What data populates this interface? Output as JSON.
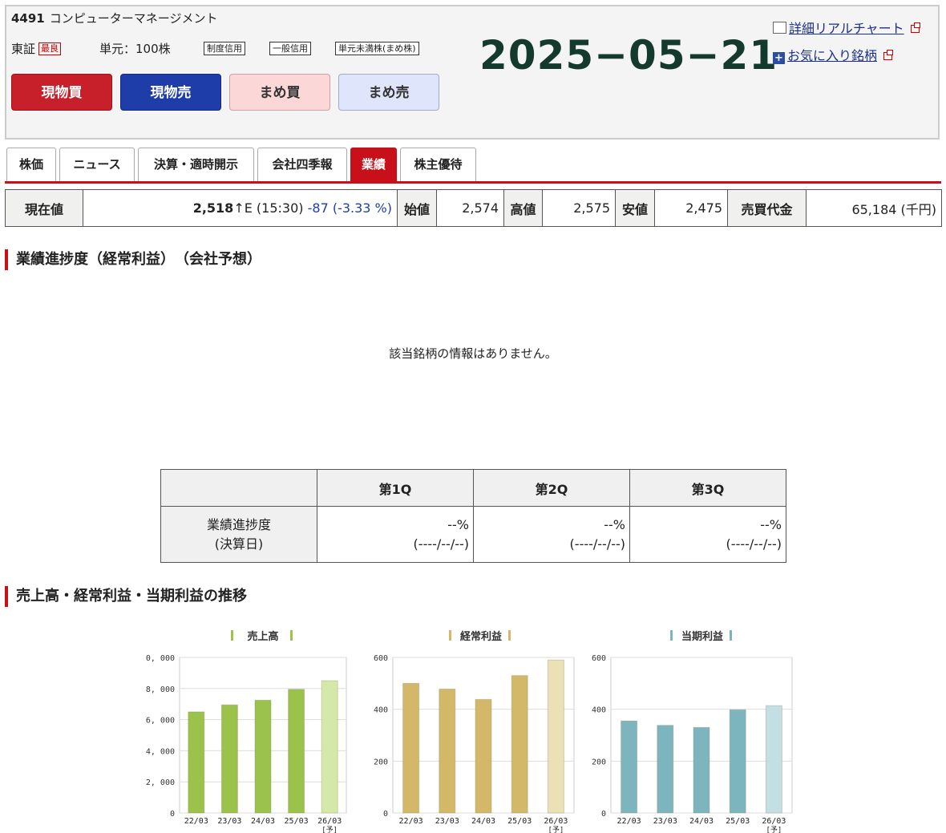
{
  "stock": {
    "code": "4491",
    "name": "コンピューターマネージメント",
    "exchange": "東証",
    "market_badge": "最良",
    "unit": "単元：100株",
    "tags": [
      "制度信用",
      "一般信用",
      "単元未満株(まめ株)"
    ]
  },
  "trade_buttons": {
    "buy": "現物買",
    "sell": "現物売",
    "mame_buy": "まめ買",
    "mame_sell": "まめ売"
  },
  "date": "2025−05−21",
  "links": {
    "chart": "詳細リアルチャート",
    "favorite": "お気に入り銘柄"
  },
  "tabs": [
    "株価",
    "ニュース",
    "決算・適時開示",
    "会社四季報",
    "業績",
    "株主優待"
  ],
  "active_tab": "業績",
  "quote": {
    "current_label": "現在値",
    "price": "2,518",
    "arrow": "↑E",
    "time": "(15:30)",
    "change": "-87 (-3.33 %)",
    "open_label": "始値",
    "open": "2,574",
    "high_label": "高値",
    "high": "2,575",
    "low_label": "安値",
    "low": "2,475",
    "volume_label": "売買代金",
    "volume": "65,184 (千円)"
  },
  "progress_section": {
    "title": "業績進捗度（経常利益）　（会社予想）",
    "no_data": "該当銘柄の情報はありません。",
    "headers": [
      "第1Q",
      "第2Q",
      "第3Q"
    ],
    "row_label_1": "業績進捗度",
    "row_label_2": "(決算日)",
    "values": [
      {
        "pct": "--%",
        "date": "(----/--/--)"
      },
      {
        "pct": "--%",
        "date": "(----/--/--)"
      },
      {
        "pct": "--%",
        "date": "(----/--/--)"
      }
    ]
  },
  "trend_section": {
    "title": "売上高・経常利益・当期利益の推移"
  },
  "chart_data": [
    {
      "type": "bar",
      "title": "売上高",
      "color": "#9bc24a",
      "forecast_color": "#d4e8a8",
      "categories": [
        "22/03",
        "23/03",
        "24/03",
        "25/03",
        "26/03"
      ],
      "forecast_note": "[予]",
      "values": [
        6500,
        6950,
        7250,
        7950,
        8500
      ],
      "yticks": [
        "0, 000",
        "8, 000",
        "6, 000",
        "4, 000",
        "2, 000",
        "0"
      ],
      "ytick_values": [
        10000,
        8000,
        6000,
        4000,
        2000,
        0
      ],
      "ylim": [
        0,
        10000
      ]
    },
    {
      "type": "bar",
      "title": "経常利益",
      "color": "#d4b86a",
      "forecast_color": "#ece0b6",
      "categories": [
        "22/03",
        "23/03",
        "24/03",
        "25/03",
        "26/03"
      ],
      "forecast_note": "[予]",
      "values": [
        500,
        478,
        438,
        530,
        590
      ],
      "yticks": [
        "600",
        "400",
        "200",
        "0"
      ],
      "ytick_values": [
        600,
        400,
        200,
        0
      ],
      "ylim": [
        0,
        600
      ]
    },
    {
      "type": "bar",
      "title": "当期利益",
      "color": "#7db5bf",
      "forecast_color": "#c4dfe3",
      "categories": [
        "22/03",
        "23/03",
        "24/03",
        "25/03",
        "26/03"
      ],
      "forecast_note": "[予]",
      "values": [
        355,
        338,
        330,
        398,
        414
      ],
      "yticks": [
        "600",
        "400",
        "200",
        "0"
      ],
      "ytick_values": [
        600,
        400,
        200,
        0
      ],
      "ylim": [
        0,
        600
      ]
    }
  ]
}
